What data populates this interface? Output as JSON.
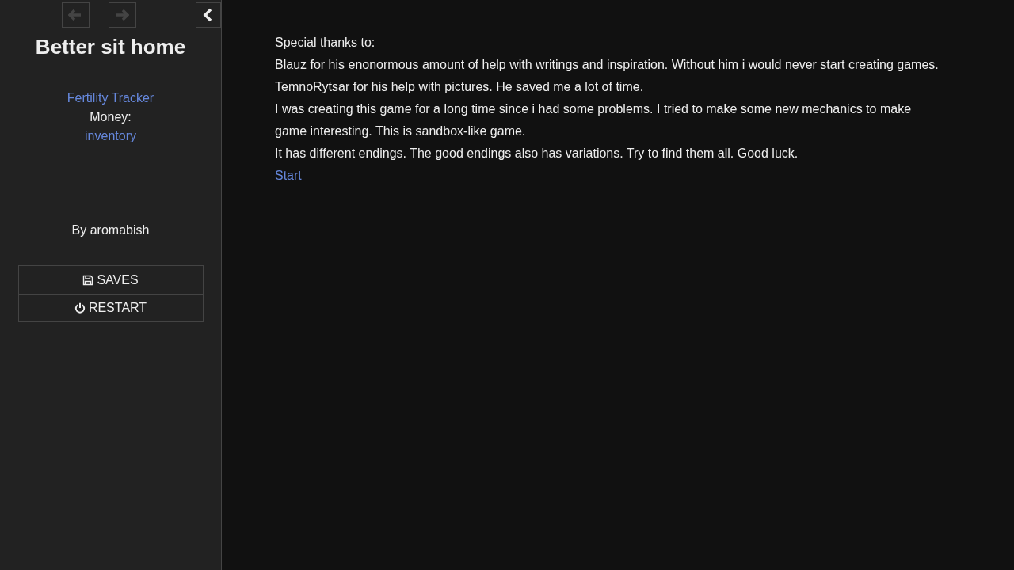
{
  "sidebar": {
    "history": [
      {
        "kind": "back",
        "disabled": true
      },
      {
        "kind": "forward",
        "disabled": true
      }
    ],
    "story_title": "Better sit home",
    "links": [
      {
        "kind": "link",
        "text": "Fertility Tracker"
      },
      {
        "kind": "text",
        "text": "Money:"
      },
      {
        "kind": "link",
        "text": "inventory"
      }
    ],
    "author": "By aromabish",
    "menu": [
      {
        "kind": "saves",
        "label": "SAVES"
      },
      {
        "kind": "restart",
        "label": "RESTART"
      }
    ]
  },
  "passage": {
    "paragraphs": [
      "Special thanks to:",
      "Blauz for his enonormous amount of help with writings and inspiration. Without him i would never start creating games.",
      "TemnoRytsar for his help with pictures. He saved me a lot of time.",
      "I was creating this game for a long time since i had some problems. I tried to make some new mechanics to make game interesting. This is sandbox-like game.",
      "It has different endings. The good endings also has variations. Try to find them all. Good luck."
    ],
    "link": "Start"
  }
}
